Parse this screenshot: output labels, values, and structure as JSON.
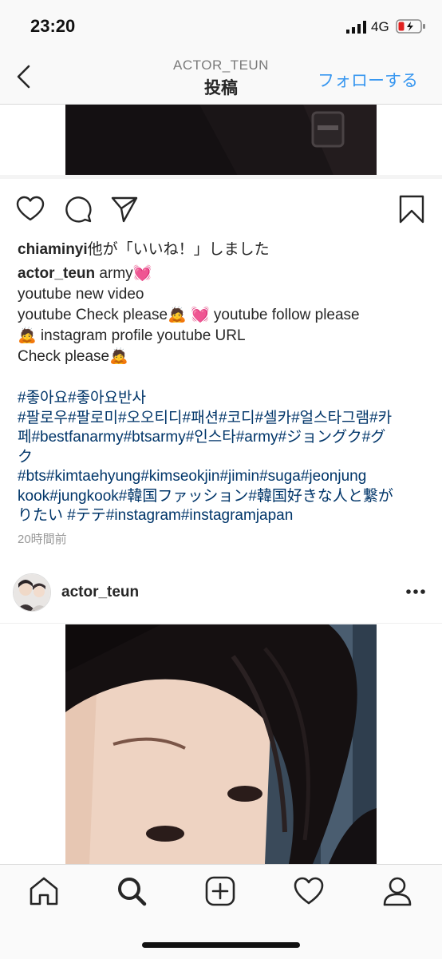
{
  "status_bar": {
    "time": "23:20",
    "network": "4G"
  },
  "nav": {
    "username": "ACTOR_TEUN",
    "title": "投稿",
    "follow_label": "フォローする"
  },
  "post": {
    "likes_user": "chiaminyi",
    "likes_suffix": "他が「いいね！」しました",
    "author": "actor_teun",
    "caption_first": "army💓",
    "caption_lines": [
      "youtube new video",
      "youtube Check please🙇 💓  youtube follow please",
      "🙇 instagram profile youtube URL",
      "Check please🙇"
    ],
    "hashtag_lines": [
      "#좋아요#좋아요반사",
      "#팔로우#팔로미#오오티디#패션#코디#셀카#얼스타그램#카",
      "페#bestfanarmy#btsarmy#인스타#army#ジョングク#グ",
      "ク",
      "#bts#kimtaehyung#kimseokjin#jimin#suga#jeonjung",
      "kook#jungkook#韓国ファッション#韓国好きな人と繋が",
      "りたい #テテ#instagram#instagramjapan"
    ],
    "timestamp": "20時間前"
  },
  "next_post": {
    "username": "actor_teun"
  },
  "icons": {
    "back": "chevron-left-icon",
    "like": "heart-icon",
    "comment": "comment-icon",
    "share": "paper-plane-icon",
    "save": "bookmark-icon",
    "more": "more-dots-icon",
    "tabs": [
      "home-icon",
      "search-icon",
      "add-post-icon",
      "activity-heart-icon",
      "profile-icon"
    ]
  },
  "colors": {
    "accent": "#3897f0",
    "hashtag": "#003569",
    "text": "#262626",
    "muted": "#999999"
  }
}
